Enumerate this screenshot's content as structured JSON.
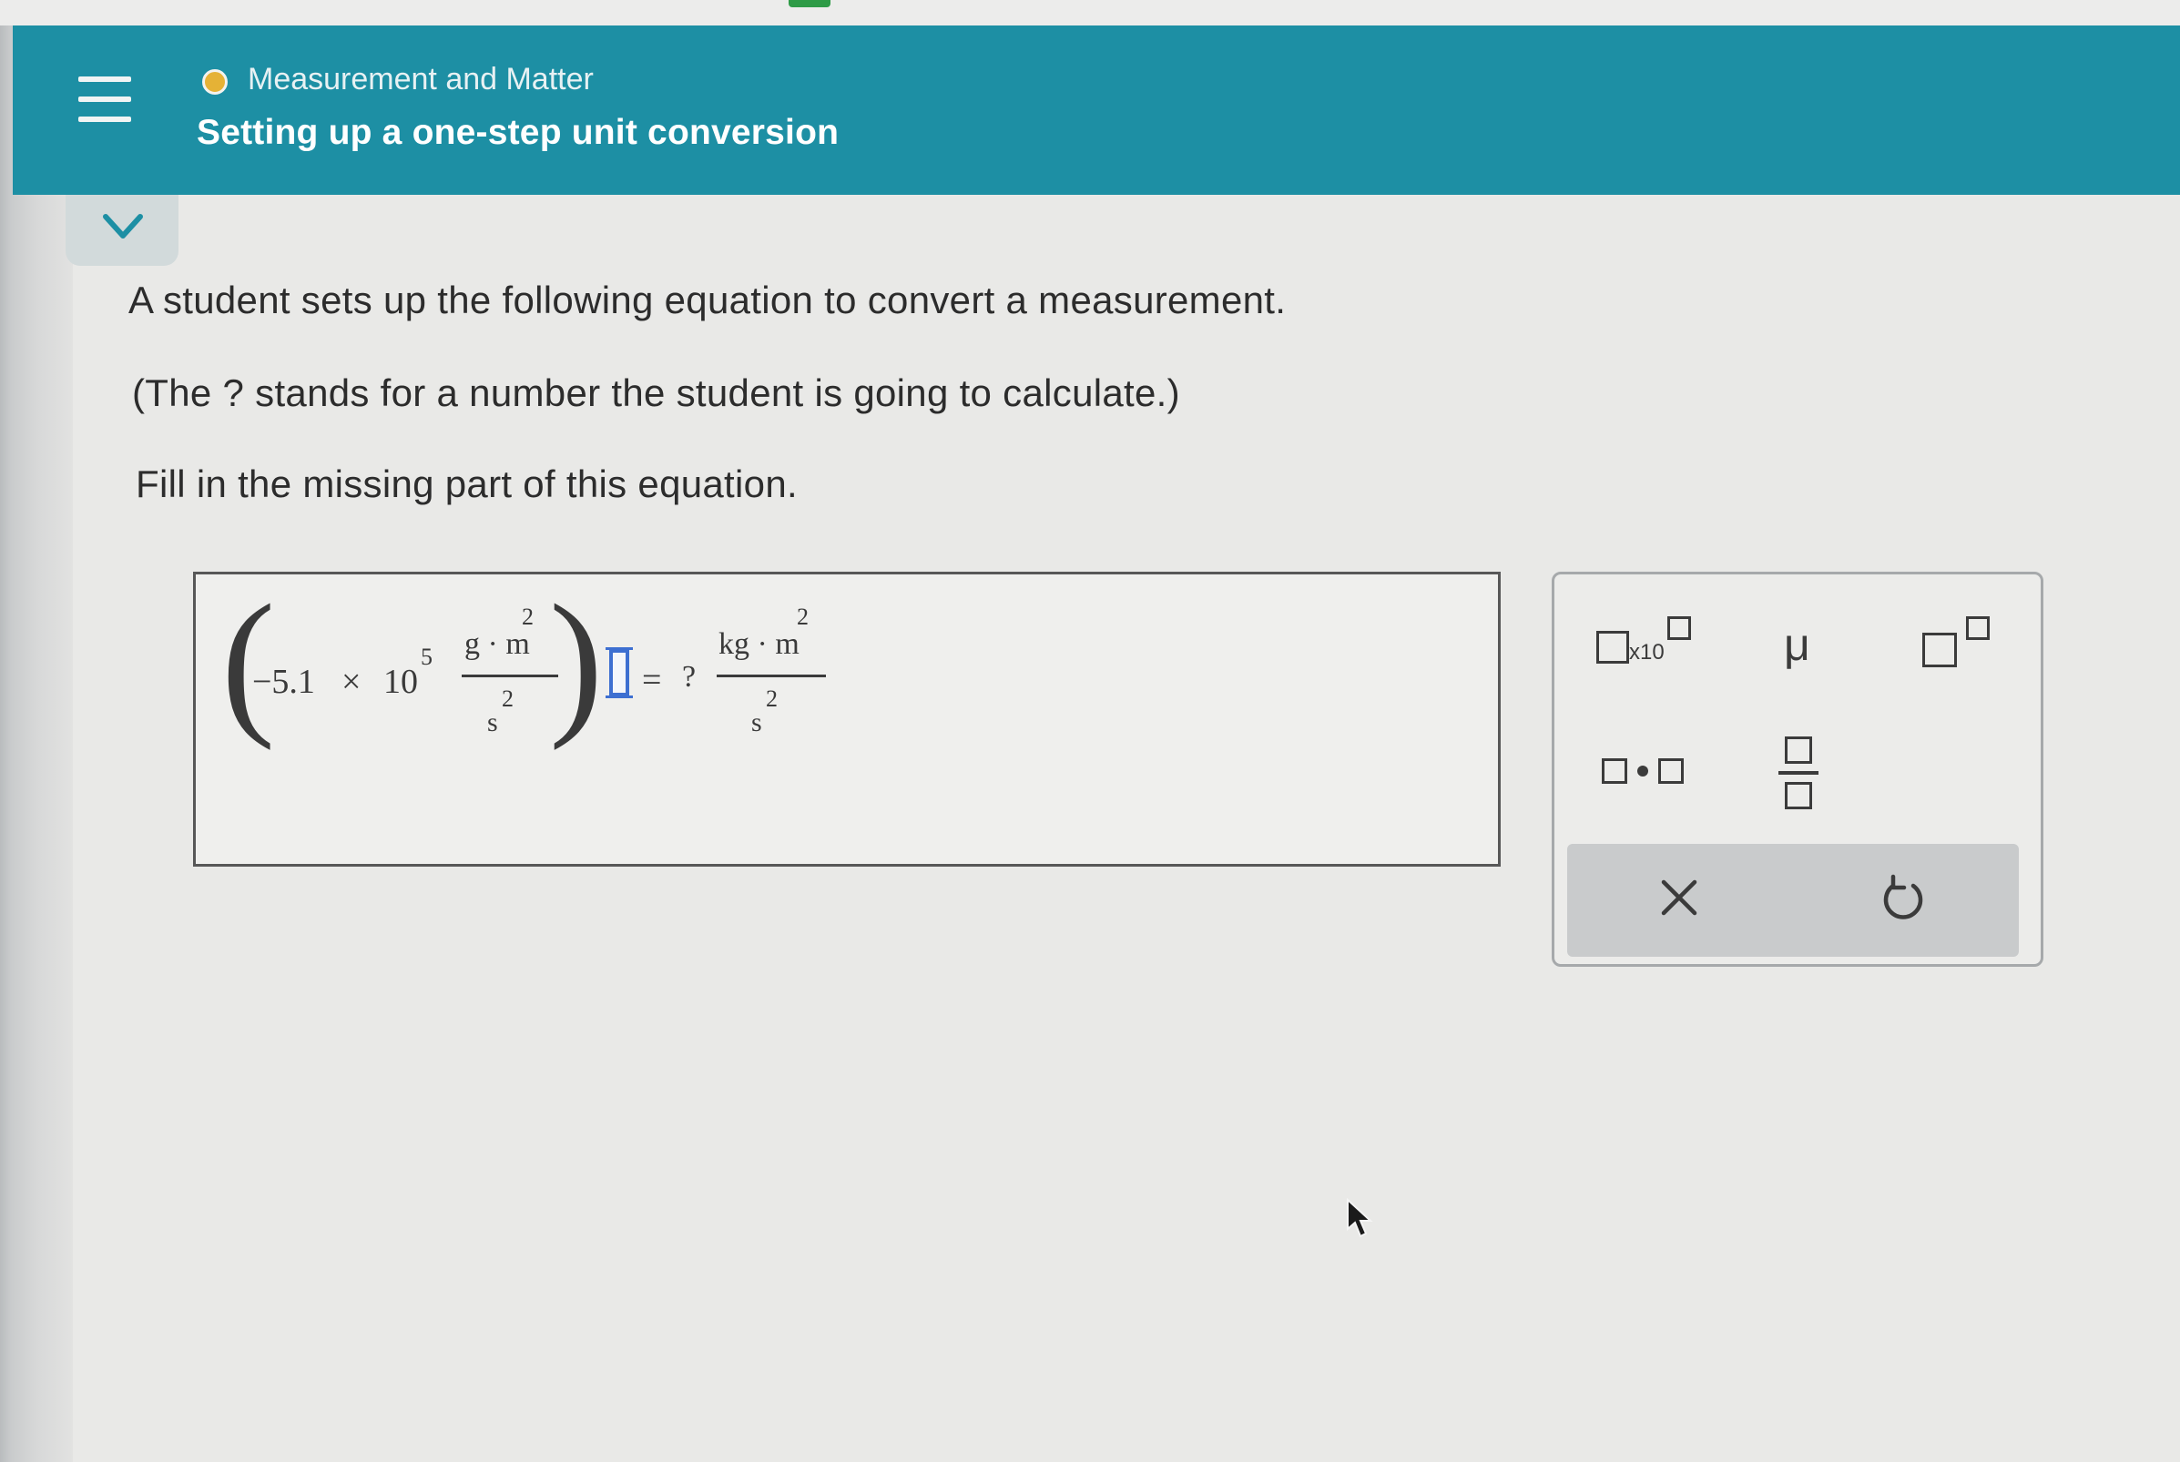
{
  "header": {
    "topic": "Measurement and Matter",
    "title": "Setting up a one-step unit conversion"
  },
  "colors": {
    "header_bg": "#1d8fa4",
    "status_dot": "#e5b236",
    "blank_box": "#3d6fd1",
    "text": "#2c2c2c"
  },
  "question": {
    "line1": "A student sets up the following equation to convert a measurement.",
    "line2": "(The ? stands for a number the student is going to calculate.)",
    "line3": "Fill in the missing part of this equation."
  },
  "equation": {
    "mantissa": "−5.1",
    "times": "×",
    "base": "10",
    "exponent": "5",
    "left_numerator": "g · m",
    "left_numerator_exp": "2",
    "left_denominator": "s",
    "left_denominator_exp": "2",
    "dot": "·",
    "equals": "=",
    "unknown": "?",
    "right_numerator": "kg · m",
    "right_numerator_exp": "2",
    "right_denominator": "s",
    "right_denominator_exp": "2"
  },
  "palette": {
    "sci_notation_label": "x10",
    "micro_symbol": "μ",
    "clear_symbol": "×",
    "icons": [
      "scientific-notation-icon",
      "micro-icon",
      "superscript-icon",
      "multiply-dot-icon",
      "fraction-icon",
      "clear-icon",
      "undo-icon"
    ]
  }
}
